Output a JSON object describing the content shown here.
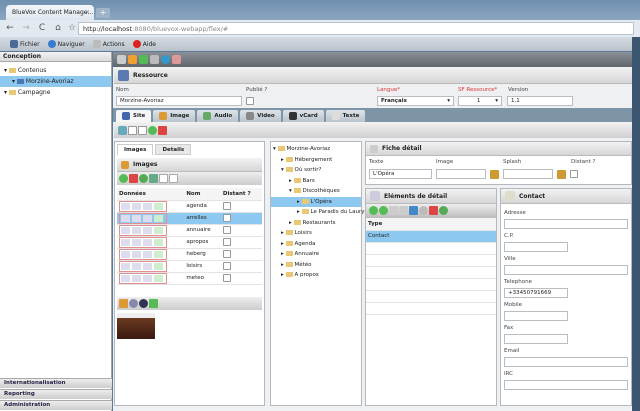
{
  "browser": {
    "tab_title": "BlueVox Content Manage...",
    "url_host": "http://localhost",
    "url_rest": ":8080/bluevox-webapp/flex/#"
  },
  "menu": {
    "items": [
      "Fichier",
      "Naviguer",
      "Actions",
      "Aide"
    ]
  },
  "sidebar": {
    "header": "Conception",
    "tree": [
      "Contenus",
      "Morzine-Avoriaz",
      "Campagne"
    ],
    "accordions": [
      "Internationalisation",
      "Reporting",
      "Administration"
    ]
  },
  "ressource": {
    "title": "Ressource",
    "nom_label": "Nom",
    "nom_value": "Morzine-Avoriaz",
    "publie_label": "Publié ?",
    "langue_label": "Langue*",
    "langue_value": "Français",
    "sf_label": "SF Ressource*",
    "sf_value": "1",
    "version_label": "Version",
    "version_value": "1.1"
  },
  "tabs": [
    "Site",
    "Image",
    "Audio",
    "Video",
    "vCard",
    "Texte"
  ],
  "images_panel": {
    "tabs": [
      "Images",
      "Details"
    ],
    "title": "Images",
    "columns": [
      "Données",
      "Nom",
      "Distant ?"
    ],
    "rows": [
      "agenda",
      "arrelles",
      "annuaire",
      "apropos",
      "heberg",
      "loisirs",
      "meteo"
    ]
  },
  "site_tree": {
    "root": "Morzine-Avoriaz",
    "items": [
      {
        "label": "Hébergement",
        "level": 1
      },
      {
        "label": "Où sortir?",
        "level": 1
      },
      {
        "label": "Bars",
        "level": 2
      },
      {
        "label": "Discothèques",
        "level": 2
      },
      {
        "label": "L'Opéra",
        "level": 3,
        "selected": true
      },
      {
        "label": "Le Paradis du Laury",
        "level": 3
      },
      {
        "label": "Restaurants",
        "level": 2
      },
      {
        "label": "Loisirs",
        "level": 1
      },
      {
        "label": "Agenda",
        "level": 1
      },
      {
        "label": "Annuaire",
        "level": 1
      },
      {
        "label": "Météo",
        "level": 1
      },
      {
        "label": "A propos",
        "level": 1
      }
    ]
  },
  "fiche": {
    "title": "Fiche détail",
    "texte_label": "Texte",
    "texte_value": "L'Opéra",
    "image_label": "Image",
    "splash_label": "Splash",
    "distant_label": "Distant ?"
  },
  "elements": {
    "title": "Eléments de détail",
    "column": "Type",
    "rows": [
      "Contact"
    ]
  },
  "contact": {
    "title": "Contact",
    "fields": [
      {
        "label": "Adresse",
        "value": ""
      },
      {
        "label": "C.P.",
        "value": ""
      },
      {
        "label": "Ville",
        "value": ""
      },
      {
        "label": "Telephone",
        "value": "+33450791669"
      },
      {
        "label": "Mobile",
        "value": ""
      },
      {
        "label": "Fax",
        "value": ""
      },
      {
        "label": "Email",
        "value": ""
      },
      {
        "label": "IRC",
        "value": ""
      }
    ]
  }
}
